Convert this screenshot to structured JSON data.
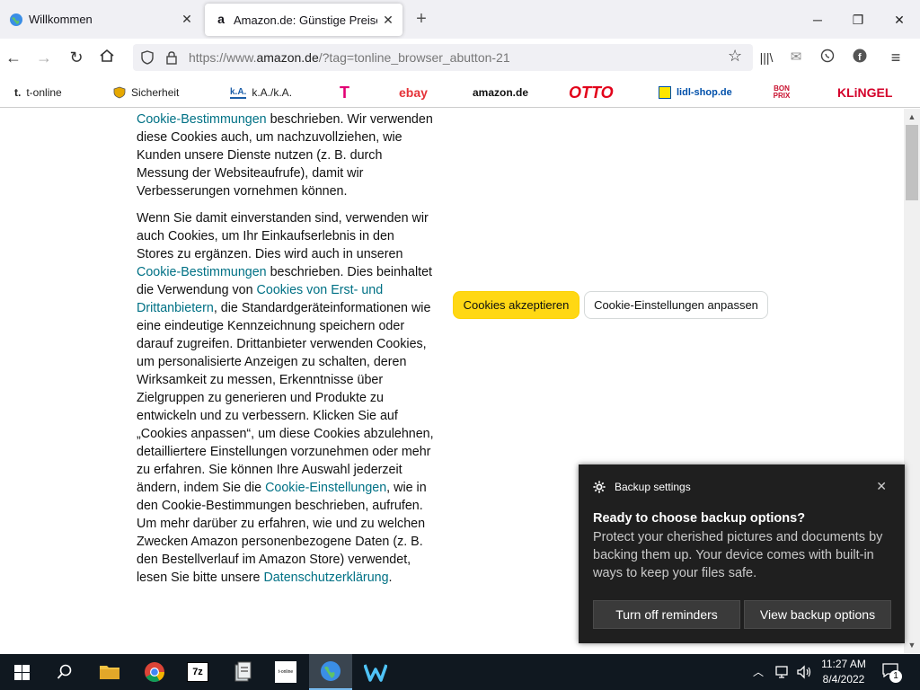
{
  "browser": {
    "tabs": [
      {
        "label": "Willkommen"
      },
      {
        "label": "Amazon.de: Günstige Preise für"
      }
    ],
    "url": {
      "prefix": "https://www.",
      "domain": "amazon.de",
      "suffix": "/?tag=tonline_browser_abutton-21"
    },
    "bookmarks": [
      {
        "label": "t-online",
        "icon": "t."
      },
      {
        "label": "Sicherheit",
        "icon": "shield-icon"
      },
      {
        "label": "k.A./k.A.",
        "icon": "k.A."
      },
      {
        "label": "T",
        "icon": "telekom-logo"
      },
      {
        "label": "ebay",
        "icon": "ebay-logo"
      },
      {
        "label": "amazon.de",
        "icon": "amazon-logo"
      },
      {
        "label": "OTTO",
        "icon": "otto-logo"
      },
      {
        "label": "lidl-shop.de",
        "icon": "lidl-logo"
      },
      {
        "label": "BON PRIX",
        "icon": "bonprix-logo"
      },
      {
        "label": "KLiNGEL",
        "icon": "klingel-logo"
      }
    ]
  },
  "cookie": {
    "p1": {
      "link1": "Cookie-Bestimmungen",
      "text1": " beschrieben. Wir verwenden diese Cookies auch, um nachzuvollziehen, wie Kunden unsere Dienste nutzen (z. B. durch Messung der Websiteaufrufe), damit wir Verbesserungen vornehmen können."
    },
    "p2": {
      "text1": "Wenn Sie damit einverstanden sind, verwenden wir auch Cookies, um Ihr Einkaufserlebnis in den Stores zu ergänzen. Dies wird auch in unseren ",
      "link1": "Cookie-Bestimmungen",
      "text2": " beschrieben. Dies beinhaltet die Verwendung von ",
      "link2": "Cookies von Erst- und Drittanbietern",
      "text3": ", die Standardgeräteinformationen wie eine eindeutige Kennzeichnung speichern oder darauf zugreifen. Drittanbieter verwenden Cookies, um personalisierte Anzeigen zu schalten, deren Wirksamkeit zu messen, Erkenntnisse über Zielgruppen zu generieren und Produkte zu entwickeln und zu verbessern. Klicken Sie auf „Cookies anpassen“, um diese Cookies abzulehnen, detailliertere Einstellungen vorzunehmen oder mehr zu erfahren. Sie können Ihre Auswahl jederzeit ändern, indem Sie die ",
      "link3": "Cookie-Einstellungen",
      "text4": ", wie in den Cookie-Bestimmungen beschrieben, aufrufen. Um mehr darüber zu erfahren, wie und zu welchen Zwecken Amazon personenbezogene Daten (z. B. den Bestellverlauf im Amazon Store) verwendet, lesen Sie bitte unsere ",
      "link4": "Datenschutzerklärung",
      "text5": "."
    },
    "accept_label": "Cookies akzeptieren",
    "settings_label": "Cookie-Einstellungen anpassen"
  },
  "toast": {
    "header": "Backup settings",
    "title": "Ready to choose backup options?",
    "body": "Protect your cherished pictures and documents by backing them up. Your device comes with built-in ways to keep your files safe.",
    "btn_off": "Turn off reminders",
    "btn_view": "View backup options"
  },
  "taskbar": {
    "time": "11:27 AM",
    "date": "8/4/2022",
    "notifications": "1"
  },
  "colors": {
    "accent_yellow": "#ffd814",
    "link": "#007185"
  }
}
